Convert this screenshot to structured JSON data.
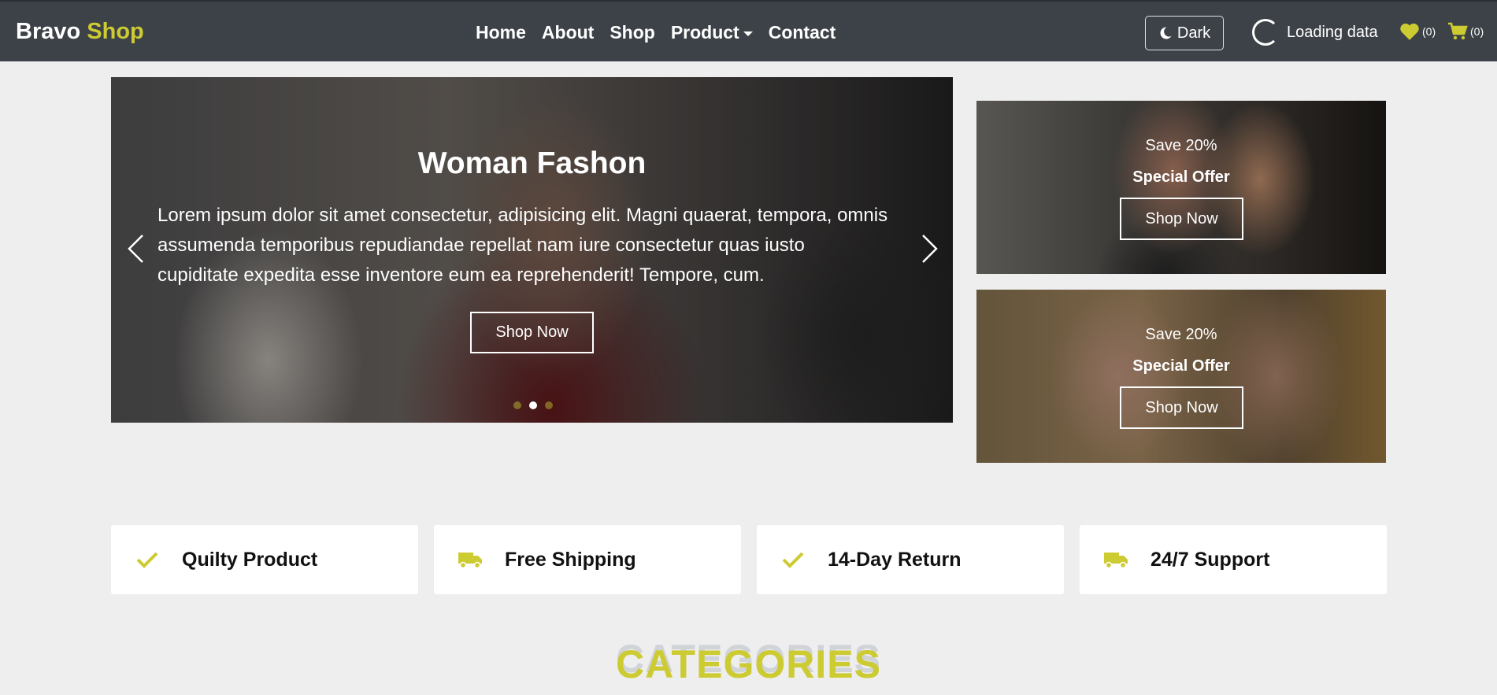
{
  "brand": {
    "part1": "Bravo",
    "part2": "Shop"
  },
  "nav": {
    "home": "Home",
    "about": "About",
    "shop": "Shop",
    "product": "Product",
    "contact": "Contact"
  },
  "toolbar": {
    "dark_label": "Dark",
    "loading_label": "Loading data",
    "wishlist_count": "(0)",
    "cart_count": "(0)"
  },
  "hero": {
    "title": "Woman Fashon",
    "text": "Lorem ipsum dolor sit amet consectetur, adipisicing elit. Magni quaerat, tempora, omnis assumenda temporibus repudiandae repellat nam iure consectetur quas iusto cupiditate expedita esse inventore eum ea reprehenderit! Tempore, cum.",
    "button": "Shop Now"
  },
  "offers": [
    {
      "save": "Save 20%",
      "title": "Special Offer",
      "button": "Shop Now"
    },
    {
      "save": "Save 20%",
      "title": "Special Offer",
      "button": "Shop Now"
    }
  ],
  "features": [
    {
      "label": "Quilty Product",
      "icon": "check-icon"
    },
    {
      "label": "Free Shipping",
      "icon": "truck-icon"
    },
    {
      "label": "14-Day Return",
      "icon": "check-icon"
    },
    {
      "label": "24/7 Support",
      "icon": "truck-icon"
    }
  ],
  "categories": {
    "heading": "CATEGORIES"
  },
  "colors": {
    "accent": "#cdcb32",
    "navbar": "#3d4248",
    "background": "#eeeeee"
  }
}
